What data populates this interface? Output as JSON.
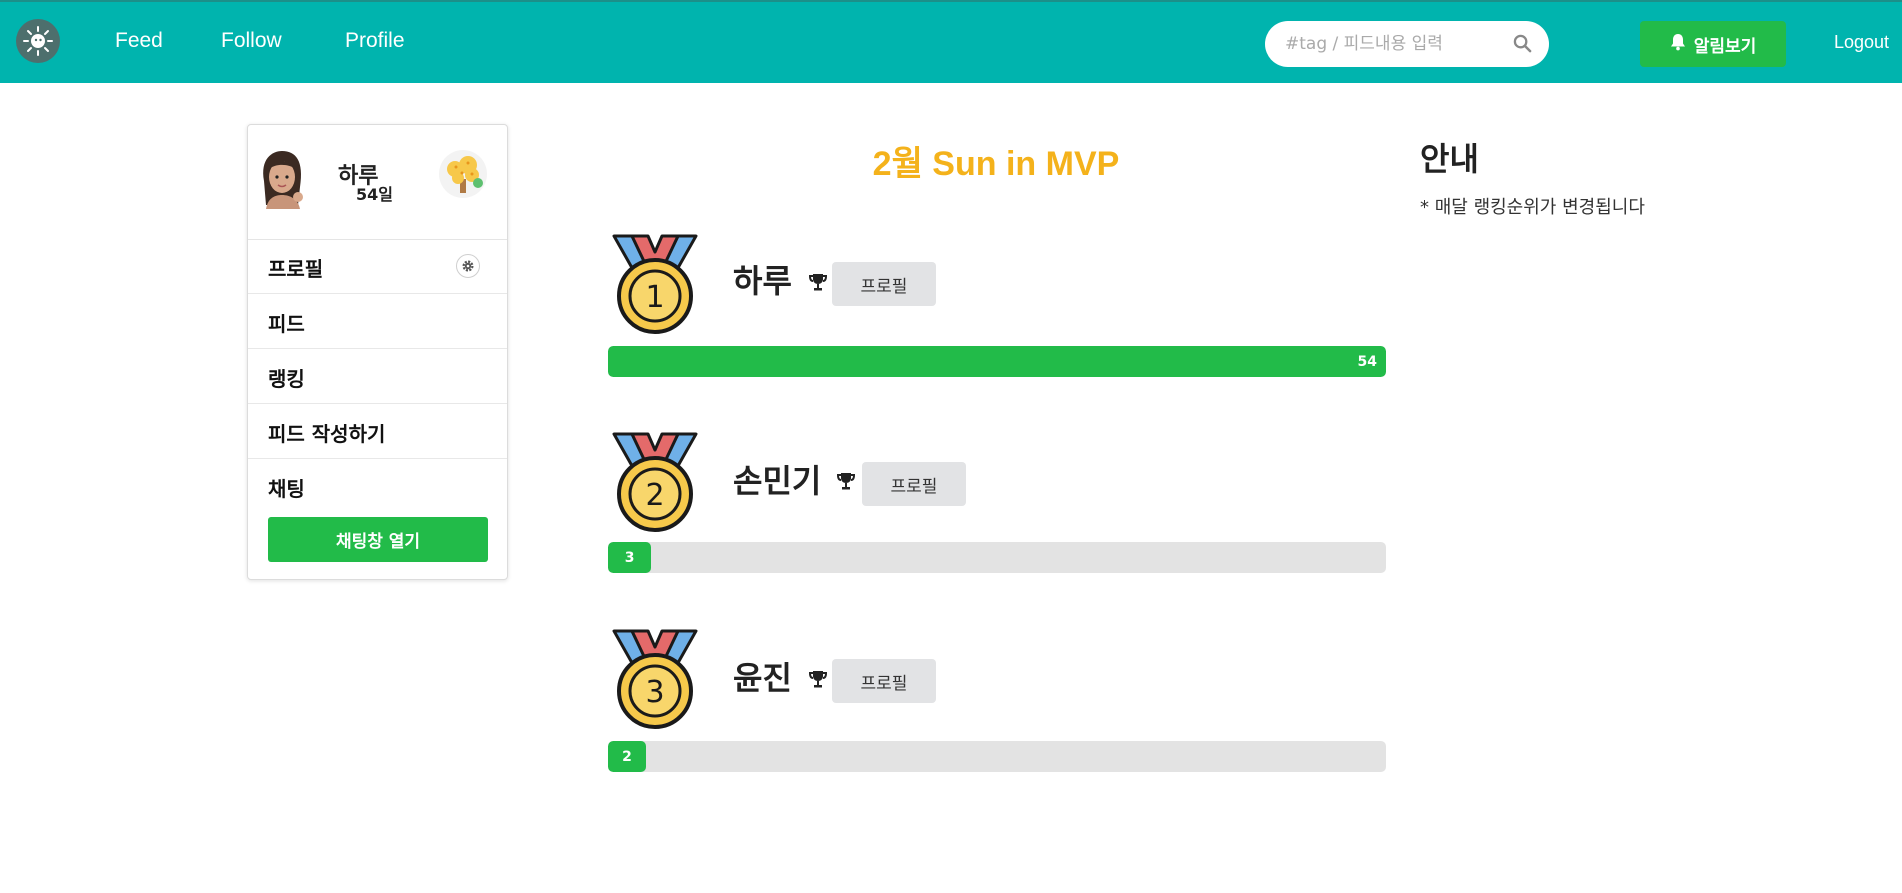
{
  "nav": {
    "links": [
      "Feed",
      "Follow",
      "Profile"
    ],
    "search_placeholder": "#tag / 피드내용 입력",
    "alarm_label": "알림보기",
    "logout_label": "Logout",
    "bg_color": "#00b4ae"
  },
  "sidebar": {
    "user_name": "하루",
    "user_days": "54일",
    "menu": [
      "프로필",
      "피드",
      "랭킹",
      "피드 작성하기",
      "채팅"
    ],
    "chat_button": "채팅창 열기"
  },
  "main": {
    "title": "2월 Sun in MVP",
    "max_value": 54,
    "rankings": [
      {
        "rank": "1",
        "name": "하루",
        "button": "프로필",
        "value": 54,
        "value_label": "54"
      },
      {
        "rank": "2",
        "name": "손민기",
        "button": "프로필",
        "value": 3,
        "value_label": "3"
      },
      {
        "rank": "3",
        "name": "윤진",
        "button": "프로필",
        "value": 2,
        "value_label": "2"
      }
    ]
  },
  "info": {
    "title": "안내",
    "text": "* 매달 랭킹순위가 변경됩니다"
  },
  "colors": {
    "accent_green": "#22bb49",
    "title_gold": "#f4b21b"
  }
}
